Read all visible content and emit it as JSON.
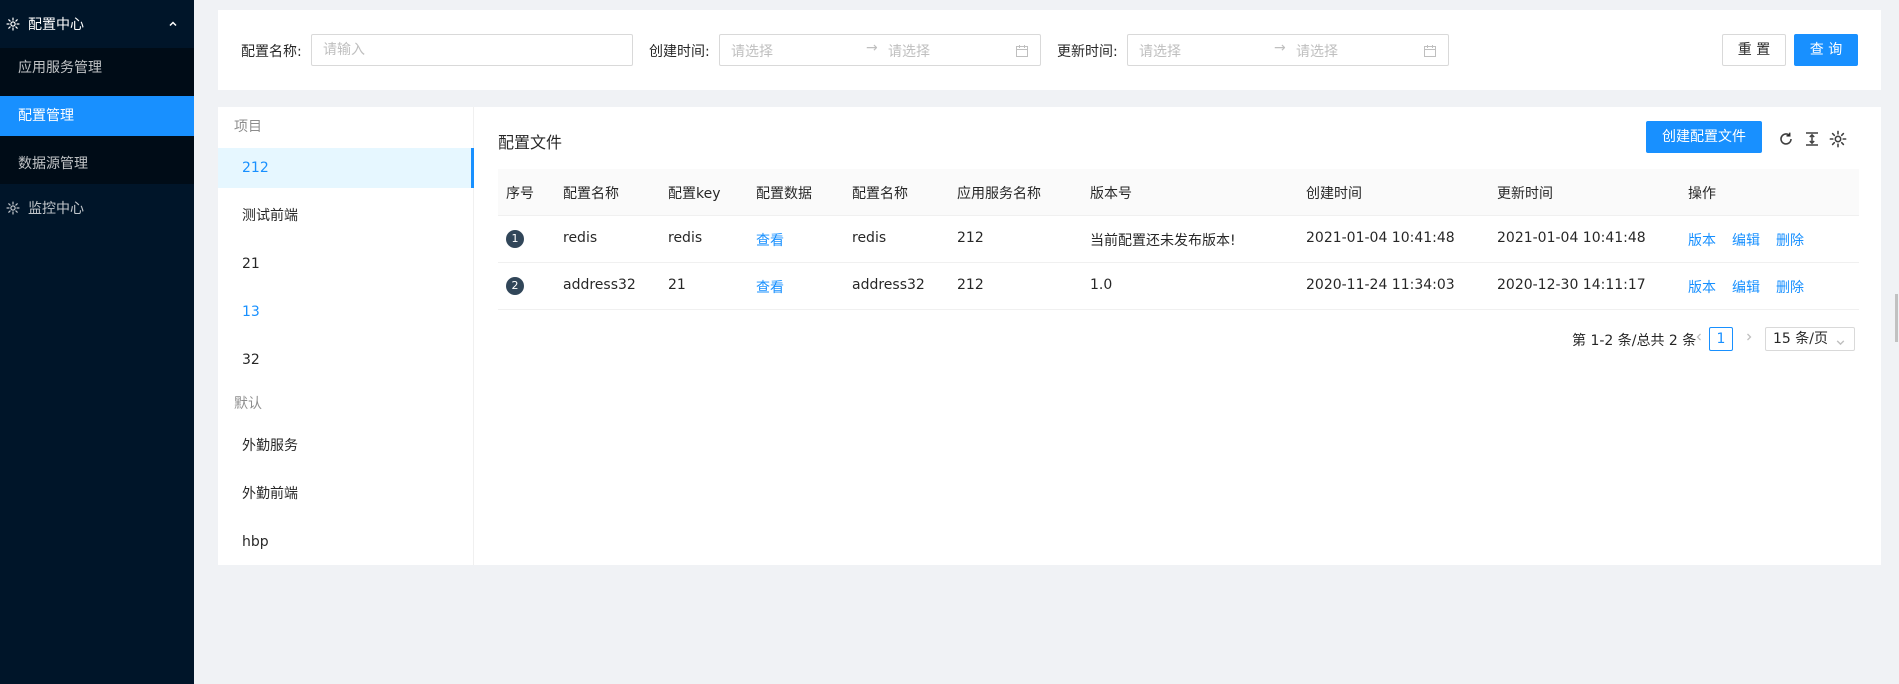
{
  "sidebar": {
    "config_center": "配置中心",
    "items": [
      {
        "label": "应用服务管理"
      },
      {
        "label": "配置管理"
      },
      {
        "label": "数据源管理"
      }
    ],
    "monitor_center": "监控中心"
  },
  "filter": {
    "name_label": "配置名称:",
    "name_placeholder": "请输入",
    "created_label": "创建时间:",
    "updated_label": "更新时间:",
    "range_placeholder_start": "请选择",
    "range_placeholder_end": "请选择",
    "range_separator": "→",
    "reset_label": "重 置",
    "search_label": "查 询"
  },
  "tree": {
    "groups": [
      {
        "title": "项目",
        "items": [
          "212",
          "测试前端",
          "21",
          "13",
          "32"
        ]
      },
      {
        "title": "默认",
        "items": [
          "外勤服务",
          "外勤前端",
          "hbp"
        ]
      }
    ]
  },
  "main": {
    "title": "配置文件",
    "create_button": "创建配置文件"
  },
  "table": {
    "columns": [
      "序号",
      "配置名称",
      "配置key",
      "配置数据",
      "配置名称",
      "应用服务名称",
      "版本号",
      "创建时间",
      "更新时间",
      "操作"
    ],
    "rows": [
      {
        "seq": "1",
        "name": "redis",
        "key": "redis",
        "data": "查看",
        "name2": "redis",
        "app": "212",
        "version": "当前配置还未发布版本!",
        "created": "2021-01-04 10:41:48",
        "updated": "2021-01-04 10:41:48",
        "actions": [
          "版本",
          "编辑",
          "删除"
        ]
      },
      {
        "seq": "2",
        "name": "address32",
        "key": "21",
        "data": "查看",
        "name2": "address32",
        "app": "212",
        "version": "1.0",
        "created": "2020-11-24 11:34:03",
        "updated": "2020-12-30 14:11:17",
        "actions": [
          "版本",
          "编辑",
          "删除"
        ]
      }
    ]
  },
  "pagination": {
    "total": "第 1-2 条/总共 2 条",
    "current": "1",
    "page_size": "15 条/页"
  },
  "colors": {
    "sidebar_bg": "#001529",
    "primary": "#1890ff",
    "selected_bg": "#e6f7ff",
    "page_bg": "#f0f2f5"
  }
}
